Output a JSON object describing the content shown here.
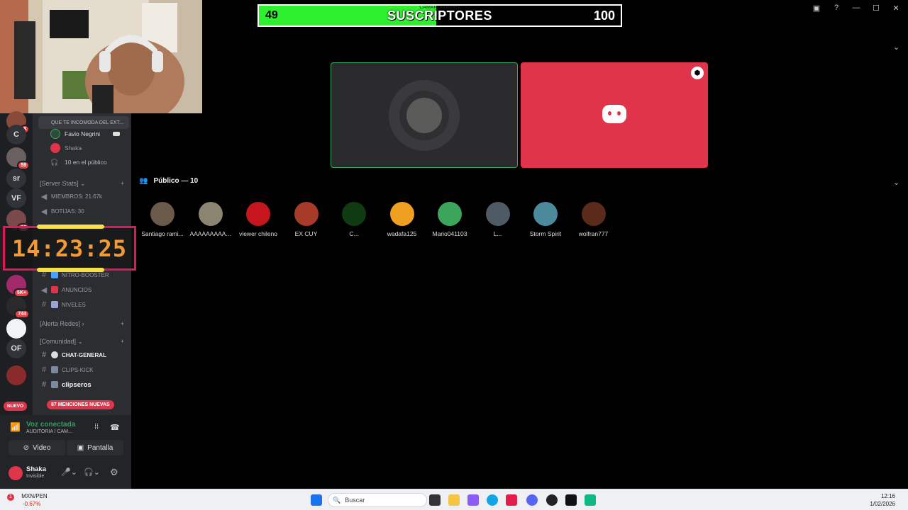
{
  "overlay": {
    "sub_goal": {
      "team": "CAMARON ARMY",
      "title": "SUSCRIPTORES",
      "current": "49",
      "goal": "100",
      "progress_fraction": 0.49,
      "fill_color": "#2ef02e"
    },
    "clock": {
      "time": "14:23:25",
      "text_color": "#f49a34",
      "border_color": "#e3165b"
    }
  },
  "servers": [
    {
      "label": "",
      "badge": "8"
    },
    {
      "label": "C",
      "badge": ""
    },
    {
      "label": "",
      "badge": "59"
    },
    {
      "label": "sr",
      "badge": ""
    },
    {
      "label": "VF",
      "badge": ""
    },
    {
      "label": "",
      "badge": "12"
    },
    {
      "label": "",
      "badge": "5K+"
    },
    {
      "label": "",
      "badge": "744"
    },
    {
      "label": "",
      "badge": ""
    },
    {
      "label": "OF",
      "badge": ""
    },
    {
      "label": "",
      "badge": ""
    }
  ],
  "channels": {
    "voice_status_snippet": "QUE TE INCOMODA DEL EXT...",
    "voice_users": [
      {
        "name": "Favio Negrini"
      },
      {
        "name": "Shaka"
      },
      {
        "name": "10 en el público"
      }
    ],
    "server_stats_category": "Server Stats",
    "stats": [
      {
        "label": "MIEMBROS: 21.67k"
      },
      {
        "label": "BOTIJAS: 30"
      }
    ],
    "info_channels": [
      {
        "label": "NITRO-BOOSTER"
      },
      {
        "label": "ANUNCIOS"
      },
      {
        "label": "NIVELES"
      }
    ],
    "alerta_category": "Alerta Redes",
    "comunidad_category": "Comunidad",
    "comunidad_channels": [
      {
        "label": "CHAT-GENERAL"
      },
      {
        "label": "CLIPS-KICK"
      },
      {
        "label": "clipseros"
      }
    ],
    "new_label": "NUEVO",
    "mentions_label": "87 MENCIONES NUEVAS"
  },
  "voice_panel": {
    "title": "Voz conectada",
    "subtitle": "AUDITORIA / CAM...",
    "video_label": "Video",
    "screen_label": "Pantalla"
  },
  "user_panel": {
    "name": "Shaka",
    "status": "Invisible"
  },
  "stage": {
    "audience_header": "Público — 10",
    "audience": [
      {
        "name": "Santiago rami...",
        "color": "#6a5a4a"
      },
      {
        "name": "AAAAAAAAA...",
        "color": "#8a8470"
      },
      {
        "name": "viewer chileno",
        "color": "#c4161c"
      },
      {
        "name": "EX CUY",
        "color": "#a83a2a"
      },
      {
        "name": "C...",
        "color": "#0f3a12"
      },
      {
        "name": "wadafa125",
        "color": "#f0a020"
      },
      {
        "name": "Mario041103",
        "color": "#3ba55c"
      },
      {
        "name": "L...",
        "color": "#4e5a66"
      },
      {
        "name": "Storm Spirit",
        "color": "#4a8a9a"
      },
      {
        "name": "wolfran777",
        "color": "#5a2a1a"
      }
    ]
  },
  "taskbar": {
    "search_placeholder": "Buscar",
    "stock_symbol": "MXN/PEN",
    "stock_change": "-0.67%",
    "stock_alert": "1",
    "time": "12:16",
    "date": "1/02/2026"
  }
}
